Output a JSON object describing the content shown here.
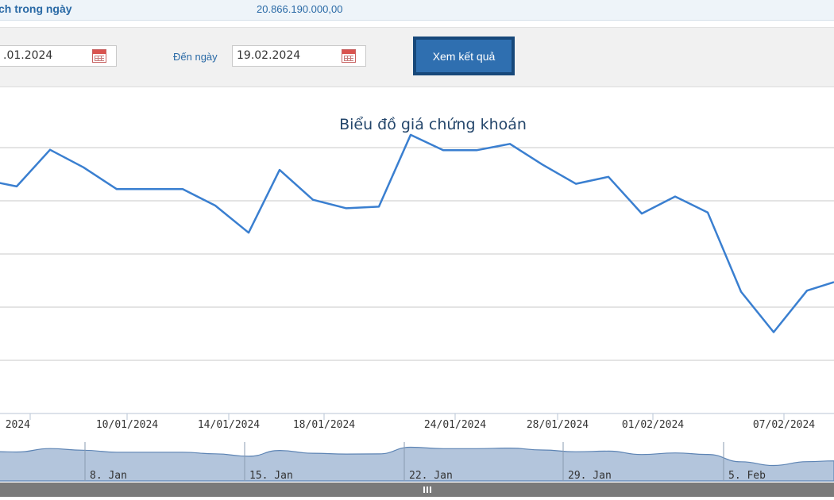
{
  "summary": {
    "label": "ch trong ngày",
    "value": "20.866.190.000,00"
  },
  "filter": {
    "from_date": ".01.2024",
    "to_label": "Đến ngày",
    "to_date": "19.02.2024",
    "submit_label": "Xem kết quả"
  },
  "chart_data": {
    "type": "line",
    "title": "Biểu đồ giá chứng khoán",
    "xlabel": "",
    "ylabel": "",
    "grid": true,
    "color": "#3a7fd0",
    "x_ticks": [
      "2024",
      "10/01/2024",
      "14/01/2024",
      "18/01/2024",
      "24/01/2024",
      "28/01/2024",
      "01/02/2024",
      "07/02/2024"
    ],
    "x": [
      "",
      "",
      "",
      "",
      "",
      "",
      "",
      "",
      "",
      "",
      "",
      "",
      "",
      "",
      "",
      "",
      "",
      "",
      "",
      "",
      "",
      "",
      "",
      "",
      "",
      ""
    ],
    "values": [
      4.34,
      4.27,
      4.96,
      4.63,
      4.22,
      4.22,
      4.22,
      3.91,
      3.4,
      4.58,
      4.02,
      3.86,
      3.89,
      5.24,
      4.95,
      4.95,
      5.07,
      4.68,
      4.32,
      4.45,
      3.76,
      4.08,
      3.78,
      2.29,
      1.53,
      2.31,
      2.47
    ],
    "navigator": {
      "labels": [
        "8. Jan",
        "15. Jan",
        "22. Jan",
        "29. Jan",
        "5. Feb"
      ]
    }
  }
}
